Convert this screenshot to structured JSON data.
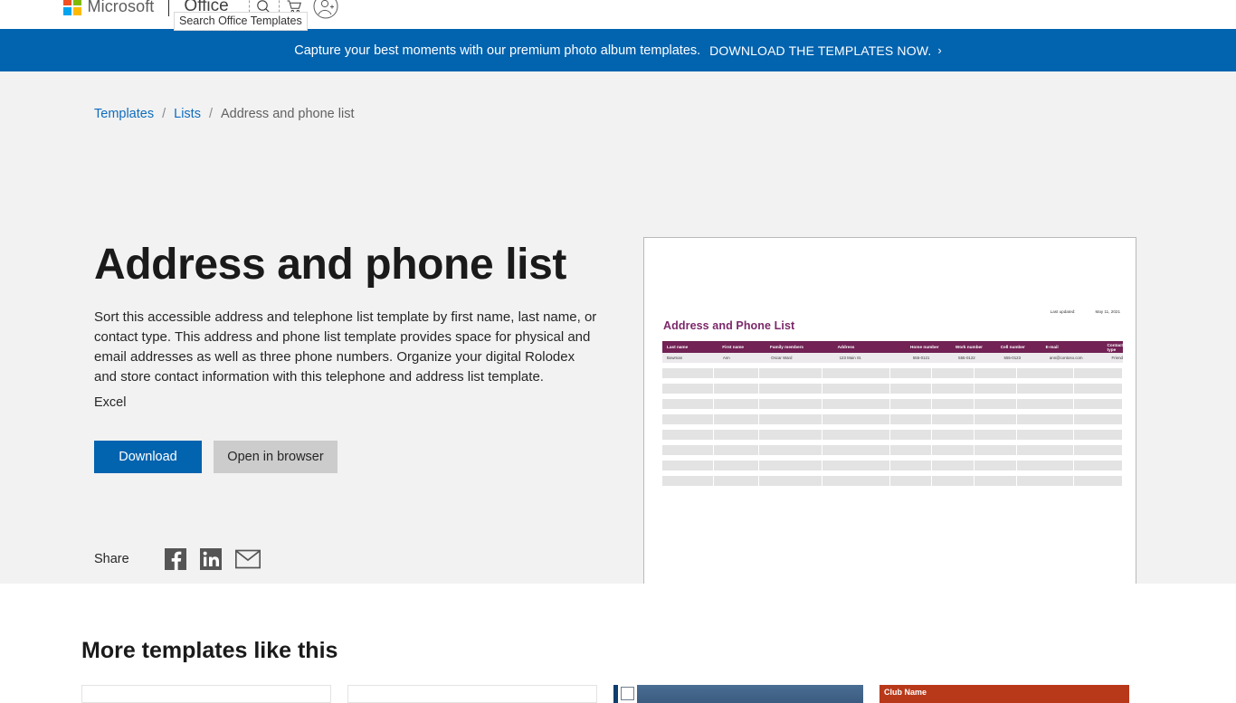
{
  "nav": {
    "brand": "Microsoft",
    "product": "Office",
    "icons": [
      "search-icon",
      "cart-icon",
      "account-icon"
    ],
    "search_tooltip": "Search Office Templates"
  },
  "promo": {
    "text": "Capture your best moments with our premium photo album templates.",
    "cta": "DOWNLOAD THE TEMPLATES NOW.",
    "chevron": "›",
    "background": "#0263af"
  },
  "breadcrumb": {
    "items": [
      {
        "label": "Templates",
        "link": true
      },
      {
        "label": "Lists",
        "link": true
      },
      {
        "label": "Address and phone list",
        "link": false
      }
    ],
    "separator": "/"
  },
  "detail": {
    "title": "Address and phone list",
    "description": "Sort this accessible address and telephone list template by first name, last name, or contact type. This address and phone list template provides space for physical and email addresses as well as three phone numbers. Organize your digital Rolodex and store contact information with this telephone and address list template.",
    "app": "Excel",
    "download_label": "Download",
    "open_label": "Open in browser",
    "download_color": "#0263af",
    "open_color": "#cccccc"
  },
  "share": {
    "label": "Share",
    "targets": [
      "facebook-icon",
      "linkedin-icon",
      "email-icon"
    ]
  },
  "preview": {
    "title": "Address and Phone List",
    "title_color": "#7b2869",
    "header_color": "#722255",
    "last_updated_label": "Last updated:",
    "last_updated_value": "May 11, 2021",
    "columns": [
      "Last name",
      "First name",
      "Family members",
      "Address",
      "Home number",
      "Work number",
      "Cell number",
      "E-mail",
      "Contact type"
    ],
    "rows": [
      [
        "Bowman",
        "Ann",
        "Oscar Ward",
        "123 Main St.",
        "555-0121",
        "555-0122",
        "555-0123",
        "ann@contoso.com",
        "Friend"
      ]
    ],
    "placeholder_row_count": 8
  },
  "more": {
    "title": "More templates like this",
    "cards": [
      {
        "name": "template-card-1",
        "kind": "plain",
        "label": ""
      },
      {
        "name": "template-card-2",
        "kind": "doc",
        "label": ""
      },
      {
        "name": "template-card-3",
        "kind": "blue",
        "label": ""
      },
      {
        "name": "template-card-4",
        "kind": "red",
        "label": "Club Name"
      }
    ]
  }
}
